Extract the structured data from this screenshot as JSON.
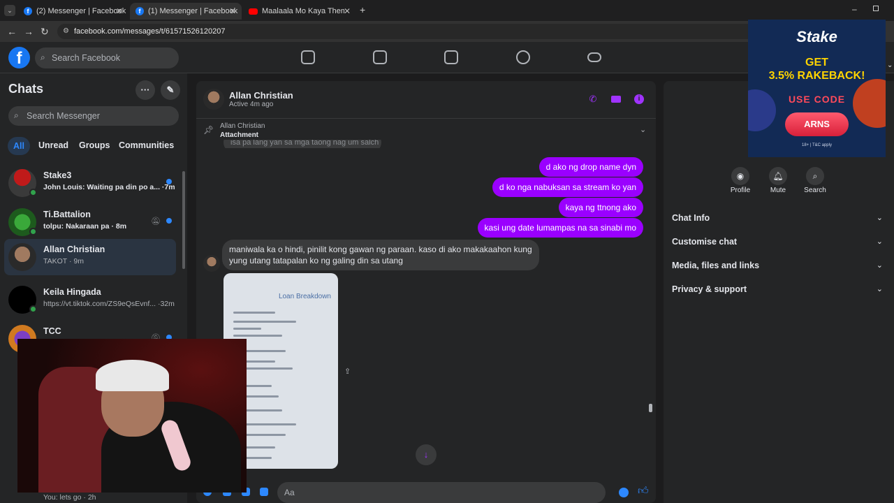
{
  "browser": {
    "tabs": [
      {
        "label": "(2) Messenger | Facebook"
      },
      {
        "label": "(1) Messenger | Facebook"
      },
      {
        "label": "Maalaala Mo Kaya Theme - Ca"
      }
    ],
    "url": "facebook.com/messages/t/61571526120207"
  },
  "fb_header": {
    "logo": "f",
    "search_placeholder": "Search Facebook",
    "nav_icons": [
      "home-icon",
      "video-icon",
      "marketplace-icon",
      "groups-icon",
      "gaming-icon"
    ]
  },
  "sidebar": {
    "title": "Chats",
    "search_placeholder": "Search Messenger",
    "filters": [
      "All",
      "Unread",
      "Groups",
      "Communities"
    ],
    "chats": [
      {
        "name": "Stake3",
        "preview": "John Louis: Waiting pa din po a... ·7m",
        "unread": true,
        "online": true
      },
      {
        "name": "Ti.Battalion",
        "preview": "tolpu: Nakaraan pa · 8m",
        "unread": true,
        "online": true
      },
      {
        "name": "Allan Christian",
        "preview": "TAKOT · 9m",
        "unread": false,
        "online": false
      },
      {
        "name": "Keila Hingada",
        "preview": "https://vt.tiktok.com/ZS9eQsEvnf... ·32m",
        "unread": false,
        "online": true
      },
      {
        "name": "TCC",
        "preview": "",
        "unread": true,
        "online": false
      }
    ],
    "last_preview": "You: lets go · 2h"
  },
  "conversation": {
    "name": "Allan Christian",
    "status": "Active 4m ago",
    "pinned": {
      "from": "Allan Christian",
      "type": "Attachment"
    },
    "partial_message": "isa pa lang yan sa mga taong nag um salch",
    "outgoing": [
      "d ako ng drop name dyn",
      "d ko nga nabuksan sa stream ko yan",
      "kaya ng ttnong ako",
      "kasi ung date lumampas na sa sinabi mo"
    ],
    "incoming_lines": [
      "maniwala ka o hindi, pinilit kong gawan ng paraan. kaso di ako makakaahon kung",
      "yung utang tatapalan ko ng galing din sa utang"
    ],
    "image_title": "Loan Breakdown",
    "composer_placeholder": "Aa"
  },
  "right_panel": {
    "actions": [
      "Profile",
      "Mute",
      "Search"
    ],
    "sections": [
      "Chat Info",
      "Customise chat",
      "Media, files and links",
      "Privacy & support"
    ]
  },
  "ad": {
    "brand": "Stake",
    "headline_1": "GET",
    "headline_2": "3.5% RAKEBACK!",
    "code_label": "USE CODE",
    "code": "ARNS",
    "terms": "18+ | T&C apply"
  },
  "colors": {
    "accent": "#9a00ff",
    "fb_blue": "#1877f2",
    "online": "#31a24c"
  }
}
